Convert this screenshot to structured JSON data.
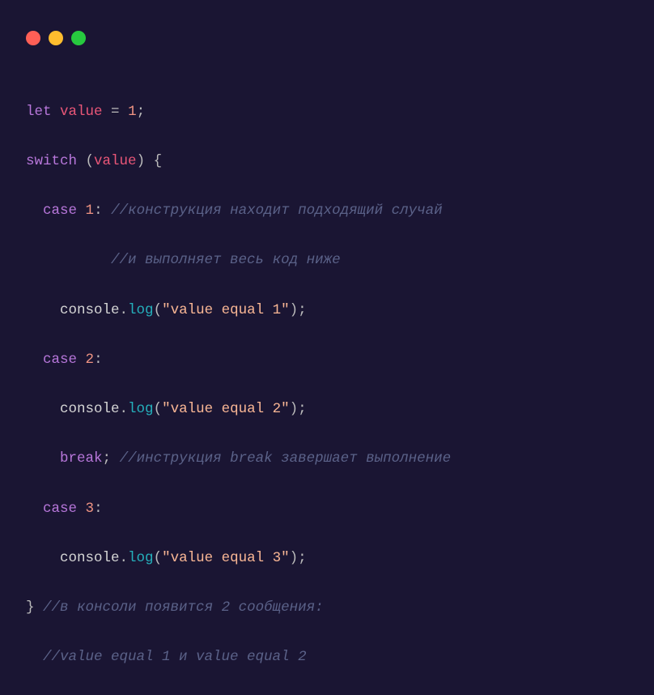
{
  "window": {
    "dots": [
      "#ff5f56",
      "#ffbd2e",
      "#27c93f"
    ]
  },
  "code": {
    "line1": {
      "let": "let",
      "ident": "value",
      "eq": " = ",
      "num": "1",
      "semi": ";"
    },
    "line2": {
      "switch": "switch",
      "sp": " ",
      "lp": "(",
      "ident": "value",
      "rp": ")",
      "sp2": " ",
      "lb": "{"
    },
    "line3": {
      "indent": "  ",
      "case": "case",
      "sp": " ",
      "num": "1",
      "colon": ":",
      "sp2": " ",
      "comment": "//конструкция находит подходящий случай"
    },
    "line4": {
      "indent": "          ",
      "comment": "//и выполняет весь код ниже"
    },
    "line5": {
      "indent": "    ",
      "obj": "console",
      "dot": ".",
      "method": "log",
      "lp": "(",
      "str": "\"value equal 1\"",
      "rp": ")",
      "semi": ";"
    },
    "line6": {
      "indent": "  ",
      "case": "case",
      "sp": " ",
      "num": "2",
      "colon": ":"
    },
    "line7": {
      "indent": "    ",
      "obj": "console",
      "dot": ".",
      "method": "log",
      "lp": "(",
      "str": "\"value equal 2\"",
      "rp": ")",
      "semi": ";"
    },
    "line8": {
      "indent": "    ",
      "break": "break",
      "semi": ";",
      "sp": " ",
      "comment": "//инструкция break завершает выполнение"
    },
    "line9": {
      "indent": "  ",
      "case": "case",
      "sp": " ",
      "num": "3",
      "colon": ":"
    },
    "line10": {
      "indent": "    ",
      "obj": "console",
      "dot": ".",
      "method": "log",
      "lp": "(",
      "str": "\"value equal 3\"",
      "rp": ")",
      "semi": ";"
    },
    "line11": {
      "rb": "}",
      "sp": " ",
      "comment": "//в консоли появится 2 сообщения:"
    },
    "line12": {
      "indent": "  ",
      "comment": "//value equal 1 и value equal 2"
    }
  }
}
